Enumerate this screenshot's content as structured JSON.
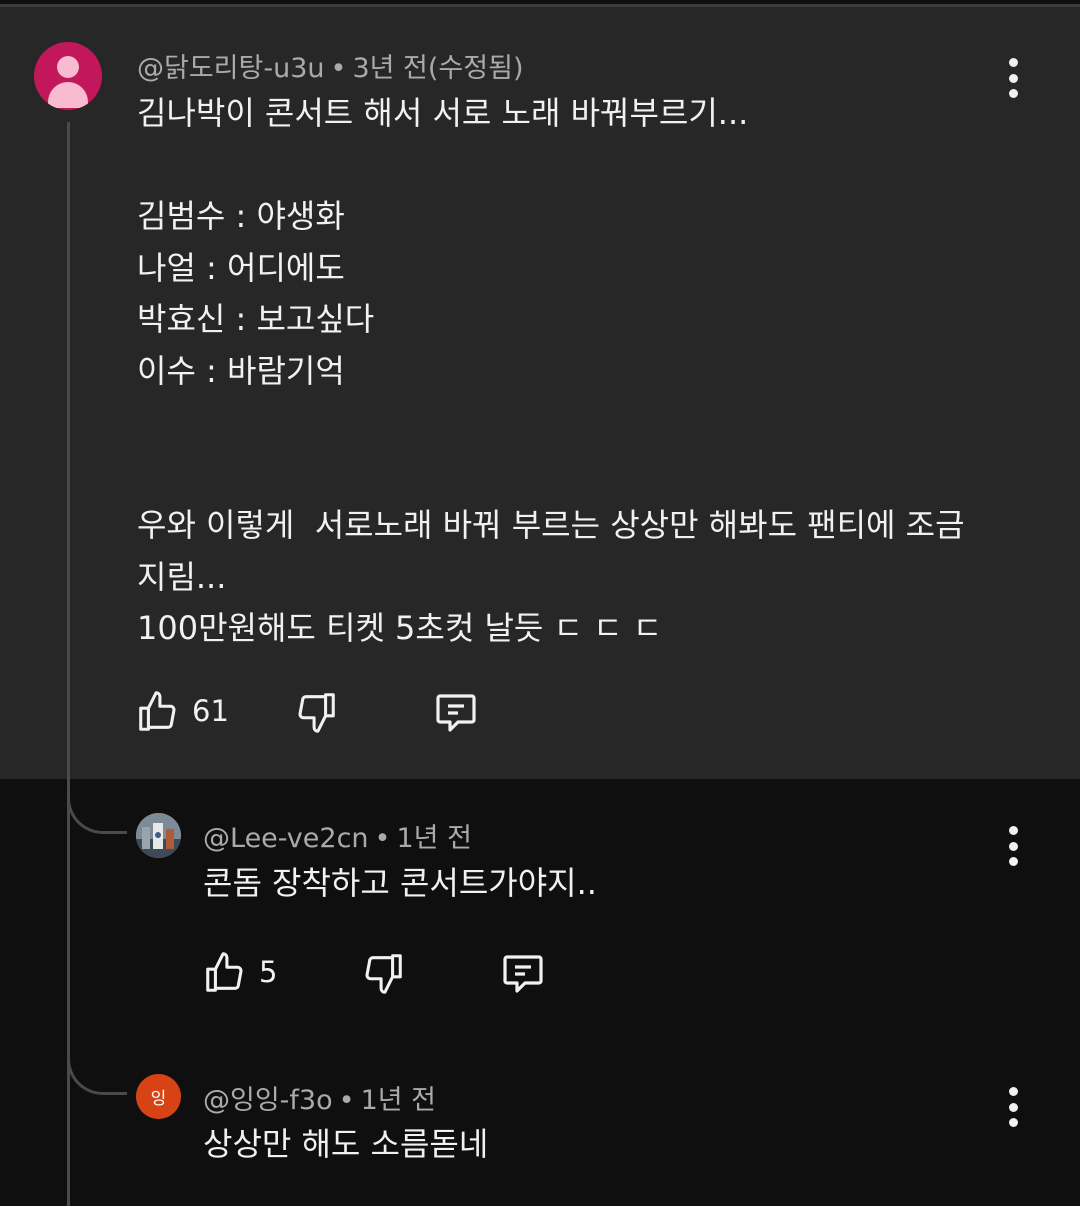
{
  "comments": [
    {
      "author": "@닭도리탕-u3u",
      "time": "3년 전(수정됨)",
      "text": "김나박이 콘서트 해서 서로 노래 바꿔부르기...\n\n김범수 : 야생화\n나얼 : 어디에도\n박효신 : 보고싶다\n이수 : 바람기억\n\n\n우와 이렇게  서로노래 바꿔 부르는 상상만 해봐도 팬티에 조금\n지림...\n100만원해도 티켓 5초컷 날듯 ㄷ ㄷ ㄷ",
      "likes": "61",
      "avatar_icon": "person-icon",
      "avatar_color": "#c2185b"
    }
  ],
  "replies": [
    {
      "author": "@Lee-ve2cn",
      "time": "1년 전",
      "text": "콘돔 장착하고 콘서트가야지..",
      "likes": "5",
      "avatar_icon": "photo-avatar"
    },
    {
      "author": "@잉잉-f3o",
      "time": "1년 전",
      "text": "상상만 해도 소름돋네",
      "avatar_letter": "잉",
      "avatar_color": "#d84315"
    }
  ],
  "separator": "•",
  "icons": {
    "like": "thumbs-up-icon",
    "dislike": "thumbs-down-icon",
    "reply": "reply-icon",
    "more": "more-vert-icon"
  }
}
